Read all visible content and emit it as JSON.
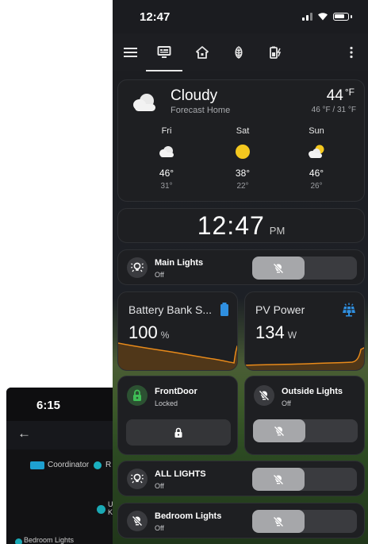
{
  "back_phone": {
    "time": "6:15",
    "legend": {
      "coordinator_label": "Coordinator",
      "router_label": "R"
    },
    "nodes": {
      "u_label": "U",
      "u_sub": "K",
      "bedroom_label": "Bedroom Lights"
    }
  },
  "status": {
    "time": "12:47"
  },
  "appbar": {
    "items": [
      {
        "icon": "hamburger-menu-icon"
      },
      {
        "icon": "monitor-dashboard-icon",
        "active": true
      },
      {
        "icon": "home-icon"
      },
      {
        "icon": "leaf-energy-icon"
      },
      {
        "icon": "battery-charging-icon"
      },
      {
        "icon": "more-vertical-icon"
      }
    ]
  },
  "weather": {
    "condition": "Cloudy",
    "location": "Forecast Home",
    "temp": "44",
    "unit": "°F",
    "hilo": "46 °F / 31 °F",
    "forecast": [
      {
        "day": "Fri",
        "icon": "cloudy-icon",
        "high": "46°",
        "low": "31°"
      },
      {
        "day": "Sat",
        "icon": "sunny-icon",
        "high": "38°",
        "low": "22°"
      },
      {
        "day": "Sun",
        "icon": "partly-cloudy-icon",
        "high": "46°",
        "low": "26°"
      }
    ]
  },
  "clock": {
    "time": "12:47",
    "ampm": "PM"
  },
  "main_lights": {
    "name": "Main Lights",
    "state": "Off"
  },
  "battery": {
    "title": "Battery Bank S...",
    "value": "100",
    "unit": "%"
  },
  "pv": {
    "title": "PV Power",
    "value": "134",
    "unit": "W"
  },
  "front_door": {
    "name": "FrontDoor",
    "state": "Locked"
  },
  "outside_lights": {
    "name": "Outside Lights",
    "state": "Off"
  },
  "all_lights": {
    "name": "ALL LIGHTS",
    "state": "Off"
  },
  "bedroom_lights": {
    "name": "Bedroom Lights",
    "state": "Off"
  },
  "colors": {
    "accent_blue": "#2f8fe0",
    "sun": "#f4c81f",
    "graph_orange": "#e88a1a",
    "lock_green": "#3fbf56"
  }
}
